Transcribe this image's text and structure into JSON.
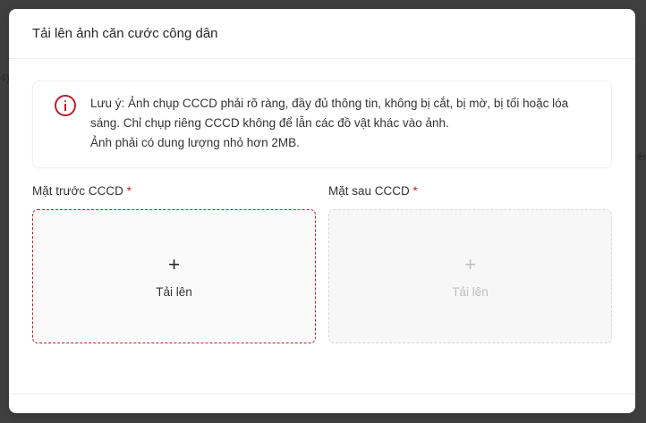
{
  "background": {
    "left_fragment": "4)",
    "right_fragment": "ên"
  },
  "modal": {
    "title": "Tải lên ảnh căn cước công dân",
    "note": {
      "icon": "info-circle-icon",
      "line1": "Lưu ý: Ảnh chụp CCCD phải rõ ràng, đầy đủ thông tin, không bị cắt, bị mờ, bị tối hoặc lóa",
      "line2": "sáng. Chỉ chụp riêng CCCD không để lẫn các đồ vật khác vào ảnh.",
      "line3": "Ảnh phải có dung lượng nhỏ hơn 2MB."
    },
    "front": {
      "label": "Mặt trước CCCD",
      "required_mark": "*",
      "plus": "+",
      "upload_text": "Tải lên"
    },
    "back": {
      "label": "Mặt sau CCCD",
      "required_mark": "*",
      "plus": "+",
      "upload_text": "Tải lên"
    }
  },
  "colors": {
    "accent": "#b8202e",
    "disabled": "#bfbfbf"
  }
}
